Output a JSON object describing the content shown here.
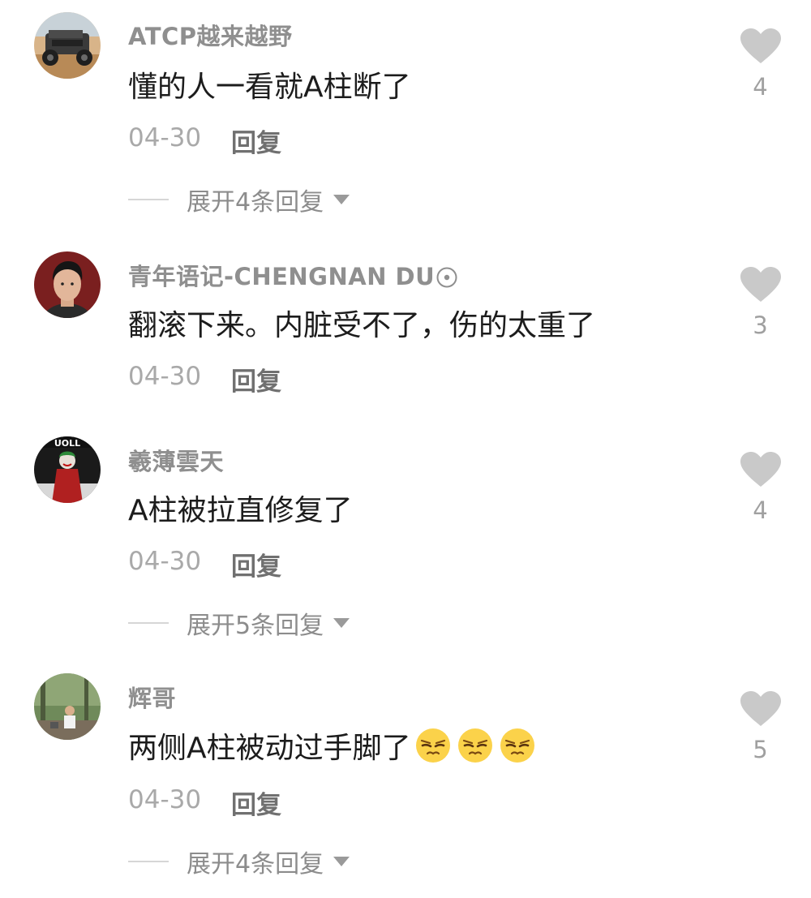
{
  "comments": [
    {
      "username": "ATCP越来越野",
      "text": "懂的人一看就A柱断了",
      "date": "04-30",
      "reply_label": "回复",
      "expand_label": "展开4条回复",
      "likes": "4",
      "avatar": "jeep-photo"
    },
    {
      "username": "青年语记-CHENGNAN DU",
      "text": "翻滚下来。内脏受不了，伤的太重了",
      "date": "04-30",
      "reply_label": "回复",
      "likes": "3",
      "avatar": "portrait-photo"
    },
    {
      "username": "羲薄雲天",
      "text": "A柱被拉直修复了",
      "date": "04-30",
      "reply_label": "回复",
      "expand_label": "展开5条回复",
      "likes": "4",
      "avatar": "joker-photo"
    },
    {
      "username": "辉哥",
      "text": "两侧A柱被动过手脚了",
      "date": "04-30",
      "reply_label": "回复",
      "expand_label": "展开4条回复",
      "likes": "5",
      "avatar": "outdoor-photo",
      "emojis": [
        "smirk-emoji",
        "smirk-emoji",
        "smirk-emoji"
      ]
    }
  ],
  "colors": {
    "username": "#8f8f8f",
    "text": "#1c1c1c",
    "meta": "#a9a9a9",
    "heart": "#c9c9c9"
  }
}
